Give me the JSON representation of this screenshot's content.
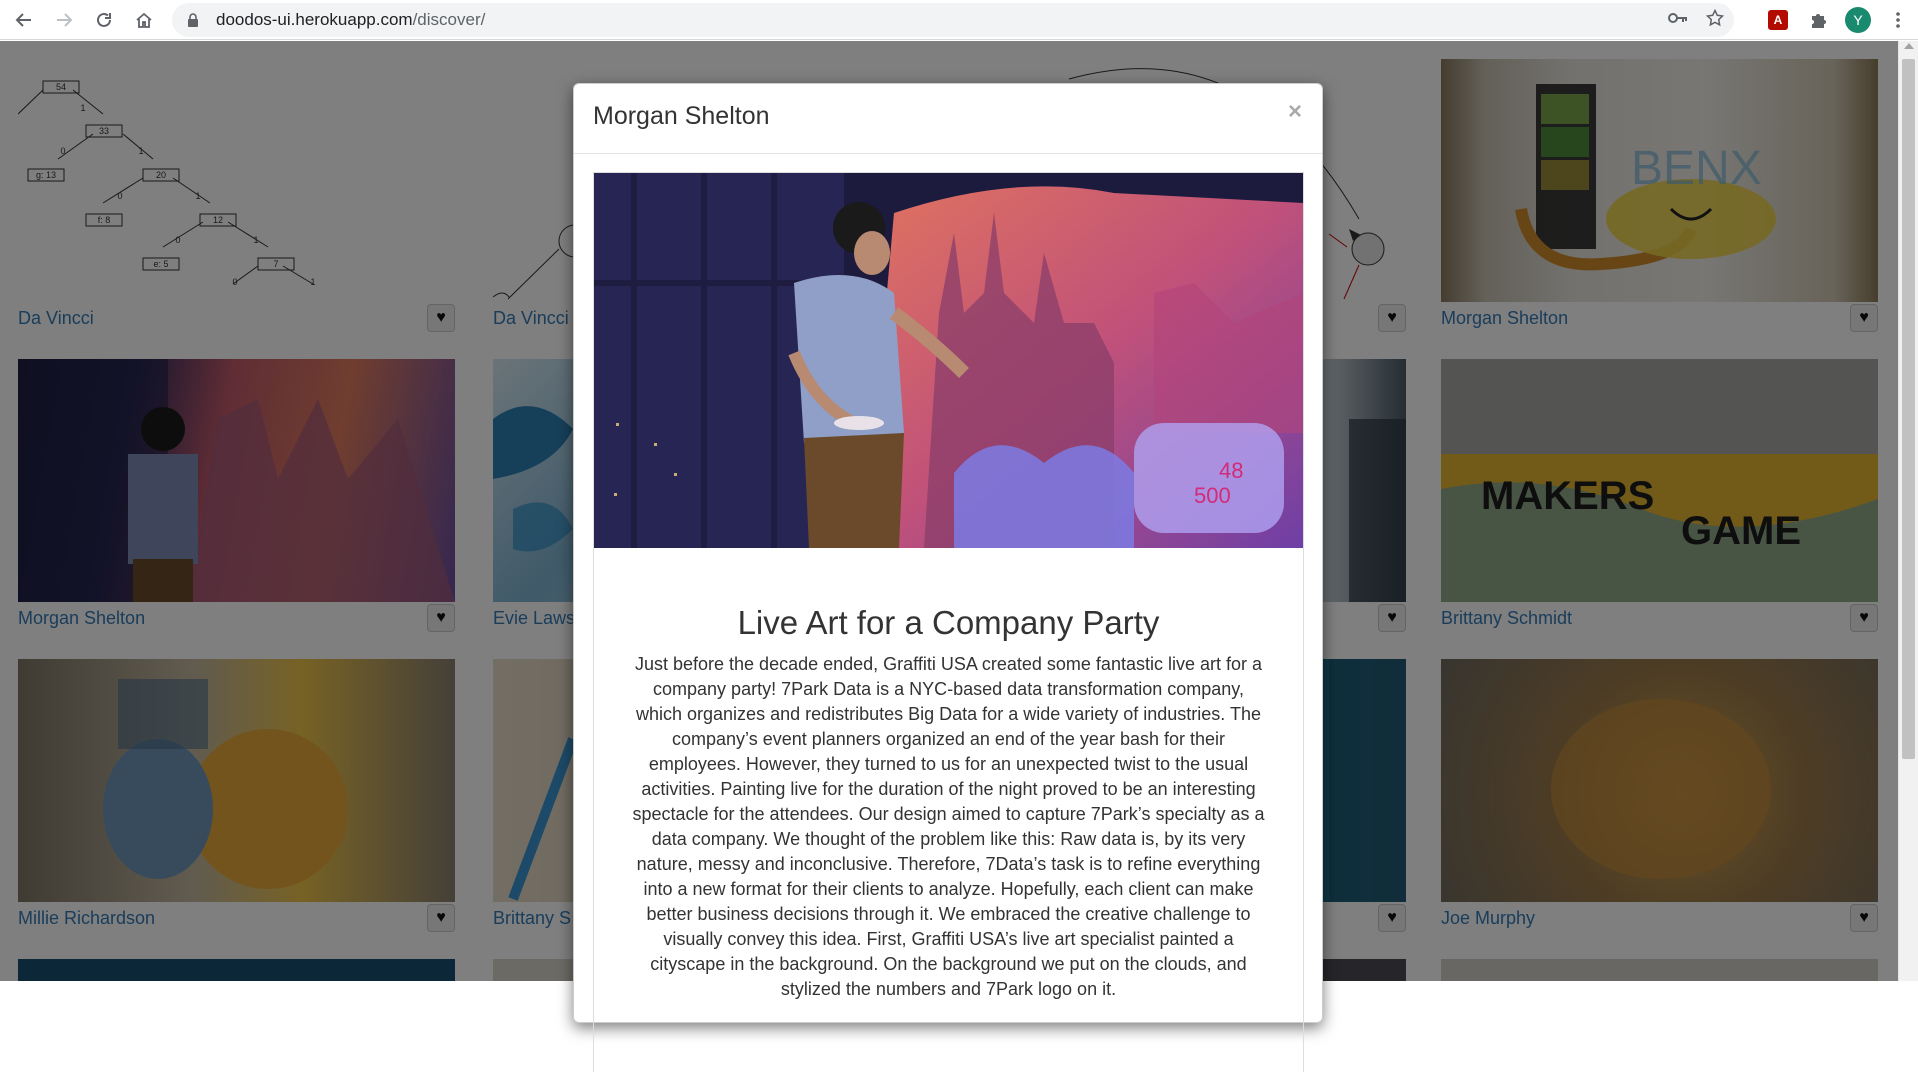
{
  "browser": {
    "url_host": "doodos-ui.herokuapp.com",
    "url_path": "/discover/",
    "profile_initial": "Y",
    "pdf_label": "A"
  },
  "grid": {
    "fav_icon": "♥",
    "cards": [
      {
        "name": "Da Vincci"
      },
      {
        "name": "Da Vincci"
      },
      {
        "name": "Morgan Shelton"
      },
      {
        "name": "Morgan Shelton"
      },
      {
        "name": "Evie Laws"
      },
      {
        "name": "Brittany Schmidt"
      },
      {
        "name": "Millie Richardson"
      },
      {
        "name": "Brittany S"
      },
      {
        "name": "Joe Murphy"
      }
    ]
  },
  "tree_labels": [
    "54",
    "33",
    "g: 13",
    "20",
    "f: 8",
    "12",
    "e: 5",
    "7",
    "1",
    "0",
    "1",
    "0",
    "1",
    "0",
    "1",
    "0",
    "1",
    "0"
  ],
  "modal": {
    "title": "Morgan Shelton",
    "close": "×",
    "post_title": "Live Art for a Company Party",
    "post_body": "Just before the decade ended, Graffiti USA created some fantastic live art for a company party! 7Park Data is a NYC-based data transformation company, which organizes and redistributes Big Data for a wide variety of industries. The company’s event planners organized an end of the year bash for their employees. However, they turned to us for an unexpected twist to the usual activities. Painting live for the duration of the night proved to be an interesting spectacle for the attendees. Our design aimed to capture 7Park’s specialty as a data company. We thought of the problem like this: Raw data is, by its very nature, messy and inconclusive. Therefore, 7Data’s task is to refine everything into a new format for their clients to analyze. Hopefully, each client can make better business decisions through it. We embraced the creative challenge to visually convey this idea. First, Graffiti USA’s live art specialist painted a cityscape in the background. On the background we put on the clouds, and stylized the numbers and 7Park logo on it."
  }
}
